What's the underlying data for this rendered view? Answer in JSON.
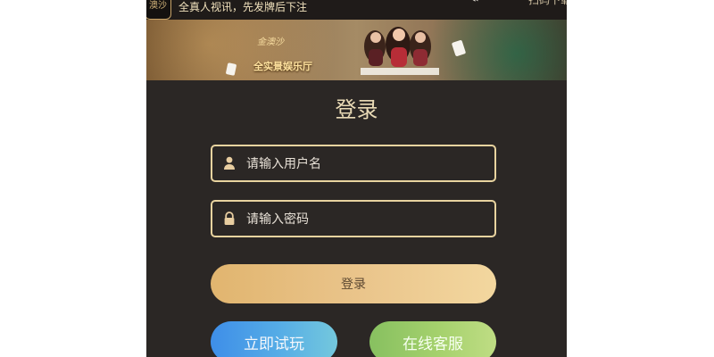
{
  "header": {
    "logo_text": "澳沙",
    "tagline": "全真人视讯，先发牌后下注",
    "download_label": "扫码下载"
  },
  "banner": {
    "brand_text": "金澳沙",
    "sub_title": "全实景娱乐厅"
  },
  "login": {
    "title": "登录",
    "username_placeholder": "请输入用户名",
    "password_placeholder": "请输入密码",
    "submit_label": "登录",
    "trial_label": "立即试玩",
    "service_label": "在线客服"
  },
  "colors": {
    "page_bg": "#2b2725",
    "gold": "#e8d39f",
    "trial_blue": "#56ade6",
    "service_green": "#a5d16d"
  },
  "icons": {
    "username": "user-icon",
    "password": "lock-icon",
    "download": "qr-code-icon"
  }
}
